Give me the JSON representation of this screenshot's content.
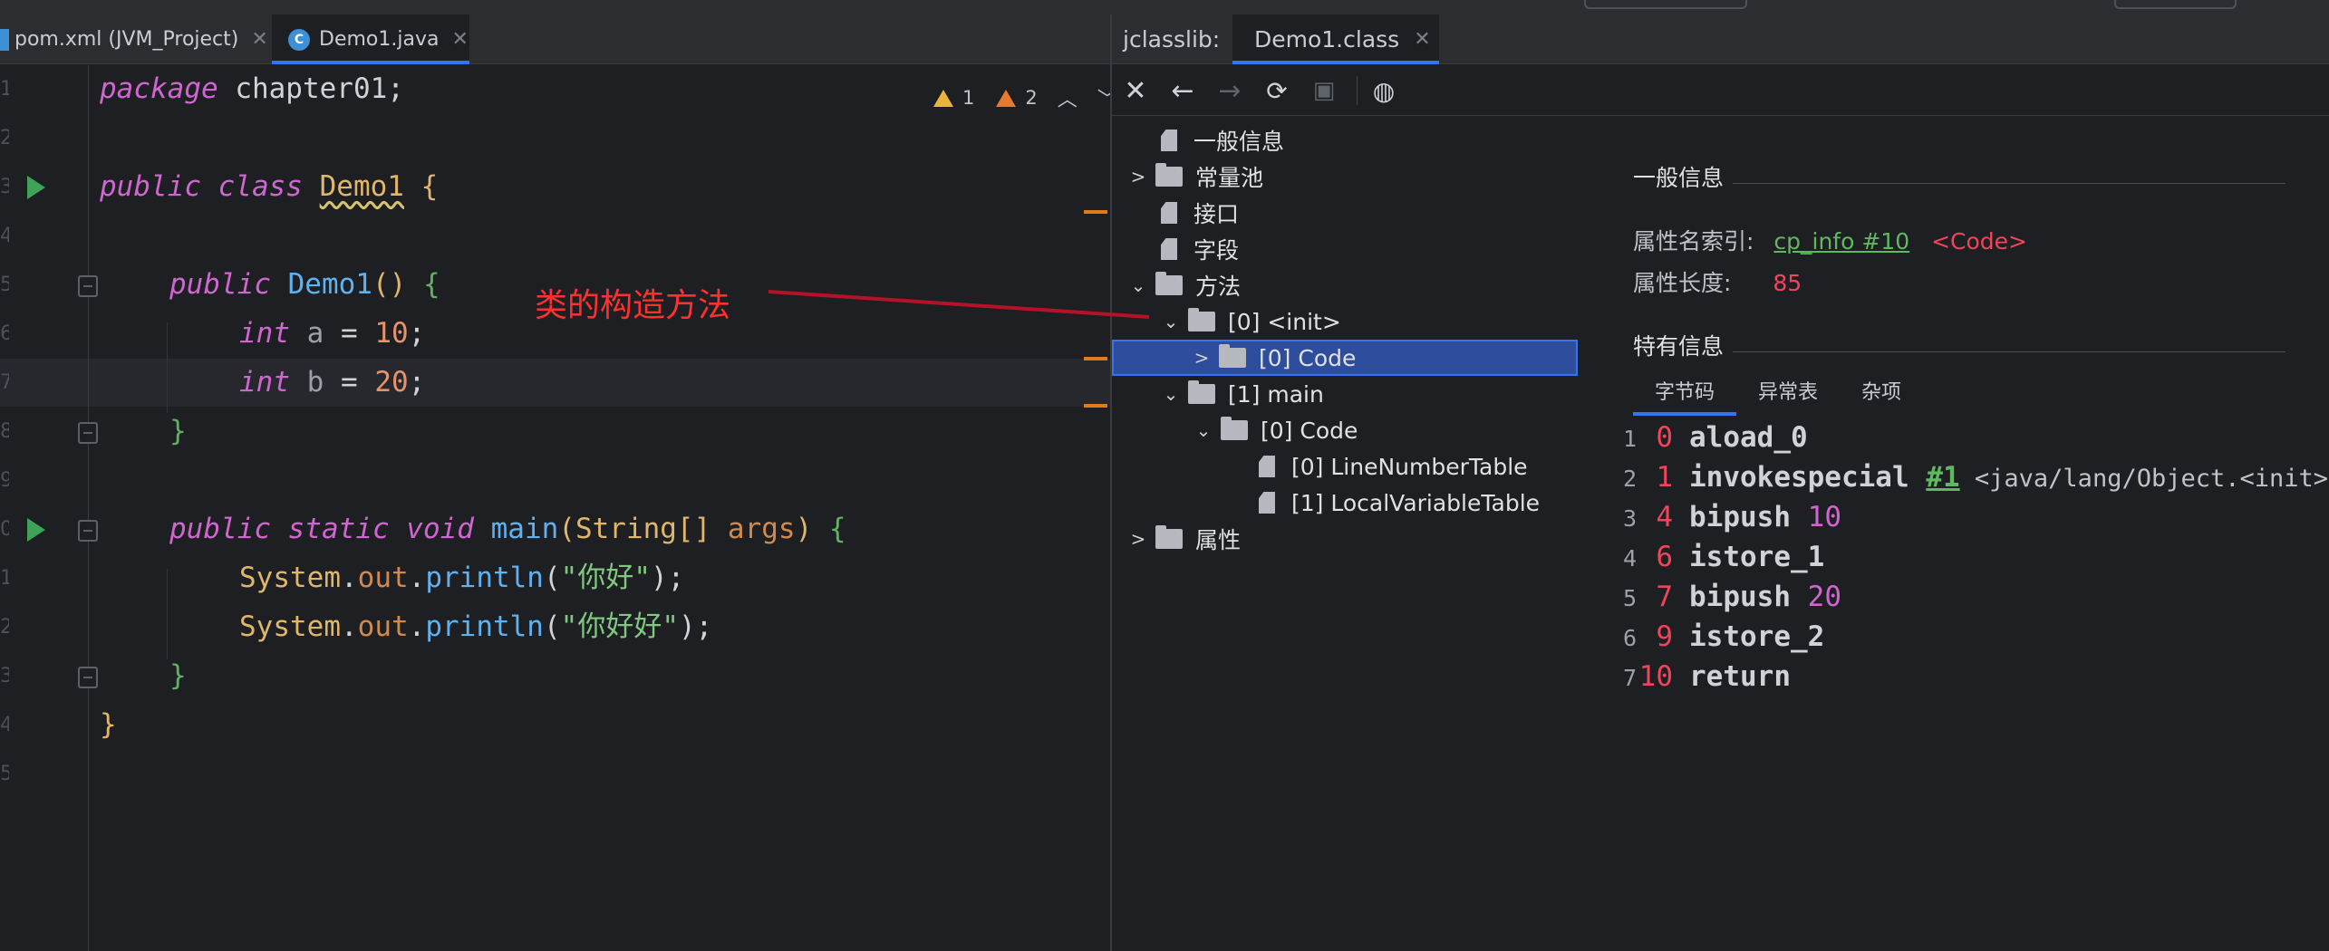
{
  "editor": {
    "tabs": [
      {
        "label": "pom.xml (JVM_Project)"
      },
      {
        "label": "Demo1.java",
        "active": true
      }
    ],
    "inspections": {
      "weak_warnings": "1",
      "warnings": "2"
    },
    "line_numbers": [
      "1",
      "2",
      "3",
      "4",
      "5",
      "6",
      "7",
      "8",
      "9",
      "0",
      "1",
      "2",
      "3",
      "4",
      "5"
    ],
    "code": {
      "l1_kw": "package",
      "l1_rest": " chapter01;",
      "l3_kw": "public class",
      "l3_name": "Demo1",
      "l3_brace": " {",
      "l5_kw": "public",
      "l5_name": " Demo1",
      "l5_paren": "()",
      "l5_brace": " {",
      "l6_kw": "int",
      "l6_var": " a",
      "l6_eq": " = ",
      "l6_num": "10",
      "l6_end": ";",
      "l7_kw": "int",
      "l7_var": " b",
      "l7_eq": " = ",
      "l7_num": "20",
      "l7_end": ";",
      "l8_brace": "}",
      "l10_kw": "public static void",
      "l10_name": " main",
      "l10_p1": "(",
      "l10_type": "String[]",
      "l10_arg": " args",
      "l10_p2": ")",
      "l10_brace": " {",
      "l11_sys": "System",
      "l11_dot1": ".",
      "l11_out": "out",
      "l11_dot2": ".",
      "l11_m": "println",
      "l11_p1": "(",
      "l11_str": "\"你好\"",
      "l11_p2": ");",
      "l12_sys": "System",
      "l12_dot1": ".",
      "l12_out": "out",
      "l12_dot2": ".",
      "l12_m": "println",
      "l12_p1": "(",
      "l12_str": "\"你好好\"",
      "l12_p2": ");",
      "l13_brace": "}",
      "l14_brace": "}"
    }
  },
  "annotation": {
    "text": "类的构造方法",
    "color": "#ff3030"
  },
  "jclasslib": {
    "title": "jclasslib:",
    "tab": "Demo1.class",
    "toolbar": [
      "close-icon",
      "back-arrow-icon",
      "forward-arrow-icon",
      "refresh-icon",
      "save-icon",
      "browser-icon"
    ],
    "tree": [
      {
        "label": "一般信息"
      },
      {
        "label": "常量池"
      },
      {
        "label": "接口"
      },
      {
        "label": "字段"
      },
      {
        "label": "方法"
      },
      {
        "label": "[0] <init>"
      },
      {
        "label": "[0] Code",
        "selected": true
      },
      {
        "label": "[1] main"
      },
      {
        "label": "[0] Code"
      },
      {
        "label": "[0] LineNumberTable"
      },
      {
        "label": "[1] LocalVariableTable"
      },
      {
        "label": "属性"
      }
    ],
    "detail": {
      "general_title": "一般信息",
      "attr_name_label": "属性名索引:",
      "attr_name_link": "cp_info #10",
      "attr_name_value": "<Code>",
      "attr_len_label": "属性长度:",
      "attr_len_value": "85",
      "specific_title": "特有信息",
      "tabs": [
        "字节码",
        "异常表",
        "杂项"
      ],
      "bytecode": [
        {
          "n": "1",
          "off": "0",
          "op": "aload_0",
          "arg": ""
        },
        {
          "n": "2",
          "off": "1",
          "op": "invokespecial",
          "ref": "#1",
          "cmt": " <java/lang/Object.<init>>"
        },
        {
          "n": "3",
          "off": "4",
          "op": "bipush",
          "arg": "10"
        },
        {
          "n": "4",
          "off": "6",
          "op": "istore_1",
          "arg": ""
        },
        {
          "n": "5",
          "off": "7",
          "op": "bipush",
          "arg": "20"
        },
        {
          "n": "6",
          "off": "9",
          "op": "istore_2",
          "arg": ""
        },
        {
          "n": "7",
          "off": "10",
          "op": "return",
          "arg": ""
        }
      ]
    }
  }
}
